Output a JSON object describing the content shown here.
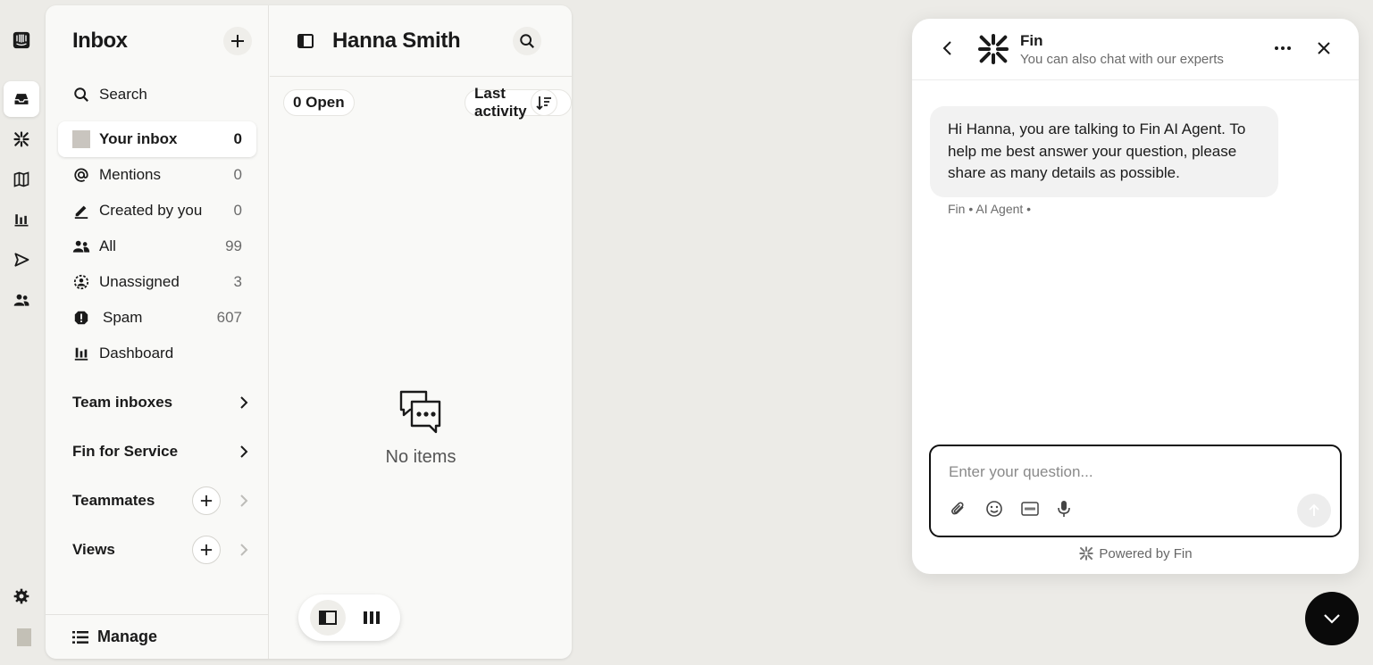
{
  "rail": {
    "items": [
      {
        "name": "logo-icon"
      },
      {
        "name": "inbox-icon",
        "active": true
      },
      {
        "name": "fin-icon"
      },
      {
        "name": "knowledge-icon"
      },
      {
        "name": "reports-icon"
      },
      {
        "name": "outbound-icon"
      },
      {
        "name": "contacts-icon"
      }
    ],
    "bottom": [
      {
        "name": "settings-icon"
      },
      {
        "name": "avatar"
      }
    ]
  },
  "sidebar": {
    "title": "Inbox",
    "search_label": "Search",
    "items": [
      {
        "label": "Your inbox",
        "count": "0",
        "icon": "avatar-icon",
        "active": true
      },
      {
        "label": "Mentions",
        "count": "0",
        "icon": "at-icon"
      },
      {
        "label": "Created by you",
        "count": "0",
        "icon": "pen-icon"
      },
      {
        "label": "All",
        "count": "99",
        "icon": "people-icon"
      },
      {
        "label": "Unassigned",
        "count": "3",
        "icon": "unassigned-icon"
      },
      {
        "label": "Spam",
        "count": "607",
        "icon": "spam-icon"
      },
      {
        "label": "Dashboard",
        "count": "",
        "icon": "dashboard-icon"
      }
    ],
    "sections": [
      {
        "label": "Team inboxes"
      },
      {
        "label": "Fin for Service"
      },
      {
        "label": "Teammates"
      },
      {
        "label": "Views"
      }
    ],
    "manage_label": "Manage"
  },
  "list": {
    "contact_name": "Hanna Smith",
    "open_filter": "0 Open",
    "sort_label": "Last activity",
    "empty_text": "No items"
  },
  "widget": {
    "title": "Fin",
    "subtitle": "You can also chat with our experts",
    "message": "Hi Hanna, you are talking to Fin AI Agent. To help me best answer your question, please share as many details as possible.",
    "meta": "Fin • AI Agent •",
    "input_placeholder": "Enter your question...",
    "powered_by": "Powered by Fin"
  },
  "colors": {
    "background": "#ecebe7",
    "panel": "#f9f9f7",
    "accent": "#0a0a0a"
  }
}
